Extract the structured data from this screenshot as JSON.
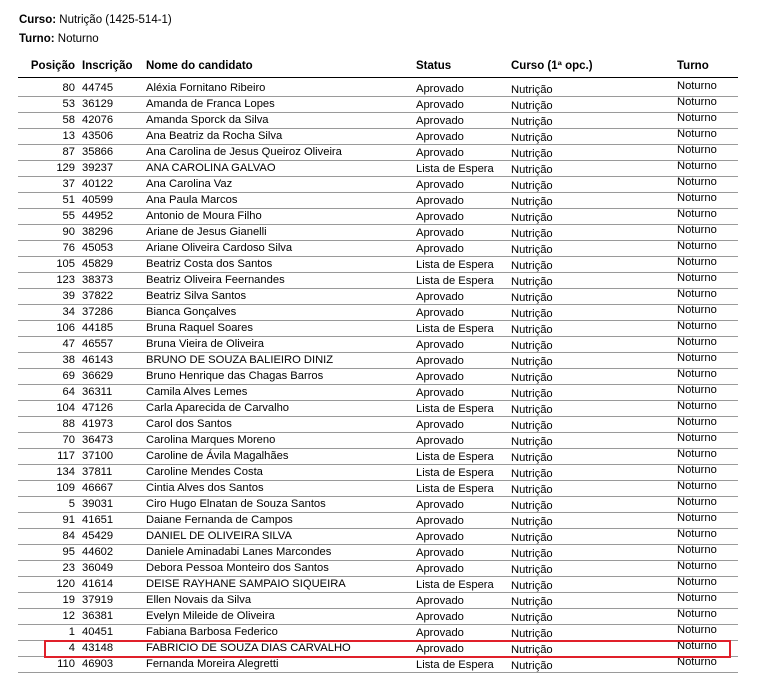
{
  "course": {
    "label": "Curso:",
    "value": "Nutrição (1425-514-1)"
  },
  "shift": {
    "label": "Turno:",
    "value": "Noturno"
  },
  "table": {
    "headers": {
      "posicao": "Posição",
      "inscricao": "Inscrição",
      "nome": "Nome do candidato",
      "status": "Status",
      "curso": "Curso (1ª opc.)",
      "turno": "Turno"
    },
    "rows": [
      {
        "pos": "80",
        "ins": "44745",
        "nome": "Aléxia Fornitano Ribeiro",
        "status": "Aprovado",
        "curso": "Nutrição",
        "turno": "Noturno"
      },
      {
        "pos": "53",
        "ins": "36129",
        "nome": "Amanda de Franca Lopes",
        "status": "Aprovado",
        "curso": "Nutrição",
        "turno": "Noturno"
      },
      {
        "pos": "58",
        "ins": "42076",
        "nome": "Amanda Sporck da Silva",
        "status": "Aprovado",
        "curso": "Nutrição",
        "turno": "Noturno"
      },
      {
        "pos": "13",
        "ins": "43506",
        "nome": "Ana Beatriz da Rocha Silva",
        "status": "Aprovado",
        "curso": "Nutrição",
        "turno": "Noturno"
      },
      {
        "pos": "87",
        "ins": "35866",
        "nome": "Ana Carolina de Jesus Queiroz Oliveira",
        "status": "Aprovado",
        "curso": "Nutrição",
        "turno": "Noturno"
      },
      {
        "pos": "129",
        "ins": "39237",
        "nome": "ANA CAROLINA GALVAO",
        "status": "Lista de Espera",
        "curso": "Nutrição",
        "turno": "Noturno"
      },
      {
        "pos": "37",
        "ins": "40122",
        "nome": "Ana Carolina Vaz",
        "status": "Aprovado",
        "curso": "Nutrição",
        "turno": "Noturno"
      },
      {
        "pos": "51",
        "ins": "40599",
        "nome": "Ana Paula Marcos",
        "status": "Aprovado",
        "curso": "Nutrição",
        "turno": "Noturno"
      },
      {
        "pos": "55",
        "ins": "44952",
        "nome": "Antonio de Moura Filho",
        "status": "Aprovado",
        "curso": "Nutrição",
        "turno": "Noturno"
      },
      {
        "pos": "90",
        "ins": "38296",
        "nome": "Ariane de Jesus Gianelli",
        "status": "Aprovado",
        "curso": "Nutrição",
        "turno": "Noturno"
      },
      {
        "pos": "76",
        "ins": "45053",
        "nome": "Ariane Oliveira Cardoso Silva",
        "status": "Aprovado",
        "curso": "Nutrição",
        "turno": "Noturno"
      },
      {
        "pos": "105",
        "ins": "45829",
        "nome": "Beatriz Costa dos Santos",
        "status": "Lista de Espera",
        "curso": "Nutrição",
        "turno": "Noturno"
      },
      {
        "pos": "123",
        "ins": "38373",
        "nome": "Beatriz Oliveira Feernandes",
        "status": "Lista de Espera",
        "curso": "Nutrição",
        "turno": "Noturno"
      },
      {
        "pos": "39",
        "ins": "37822",
        "nome": "Beatriz Silva Santos",
        "status": "Aprovado",
        "curso": "Nutrição",
        "turno": "Noturno"
      },
      {
        "pos": "34",
        "ins": "37286",
        "nome": "Bianca Gonçalves",
        "status": "Aprovado",
        "curso": "Nutrição",
        "turno": "Noturno"
      },
      {
        "pos": "106",
        "ins": "44185",
        "nome": "Bruna Raquel Soares",
        "status": "Lista de Espera",
        "curso": "Nutrição",
        "turno": "Noturno"
      },
      {
        "pos": "47",
        "ins": "46557",
        "nome": "Bruna Vieira de Oliveira",
        "status": "Aprovado",
        "curso": "Nutrição",
        "turno": "Noturno"
      },
      {
        "pos": "38",
        "ins": "46143",
        "nome": "BRUNO DE SOUZA BALIEIRO DINIZ",
        "status": "Aprovado",
        "curso": "Nutrição",
        "turno": "Noturno"
      },
      {
        "pos": "69",
        "ins": "36629",
        "nome": "Bruno Henrique das Chagas Barros",
        "status": "Aprovado",
        "curso": "Nutrição",
        "turno": "Noturno"
      },
      {
        "pos": "64",
        "ins": "36311",
        "nome": "Camila Alves Lemes",
        "status": "Aprovado",
        "curso": "Nutrição",
        "turno": "Noturno"
      },
      {
        "pos": "104",
        "ins": "47126",
        "nome": "Carla Aparecida de Carvalho",
        "status": "Lista de Espera",
        "curso": "Nutrição",
        "turno": "Noturno"
      },
      {
        "pos": "88",
        "ins": "41973",
        "nome": "Carol dos Santos",
        "status": "Aprovado",
        "curso": "Nutrição",
        "turno": "Noturno"
      },
      {
        "pos": "70",
        "ins": "36473",
        "nome": "Carolina Marques Moreno",
        "status": "Aprovado",
        "curso": "Nutrição",
        "turno": "Noturno"
      },
      {
        "pos": "117",
        "ins": "37100",
        "nome": "Caroline de Ávila Magalhães",
        "status": "Lista de Espera",
        "curso": "Nutrição",
        "turno": "Noturno"
      },
      {
        "pos": "134",
        "ins": "37811",
        "nome": "Caroline Mendes Costa",
        "status": "Lista de Espera",
        "curso": "Nutrição",
        "turno": "Noturno"
      },
      {
        "pos": "109",
        "ins": "46667",
        "nome": "Cintia Alves dos Santos",
        "status": "Lista de Espera",
        "curso": "Nutrição",
        "turno": "Noturno"
      },
      {
        "pos": "5",
        "ins": "39031",
        "nome": "Ciro Hugo Elnatan de Souza Santos",
        "status": "Aprovado",
        "curso": "Nutrição",
        "turno": "Noturno"
      },
      {
        "pos": "91",
        "ins": "41651",
        "nome": "Daiane Fernanda de Campos",
        "status": "Aprovado",
        "curso": "Nutrição",
        "turno": "Noturno"
      },
      {
        "pos": "84",
        "ins": "45429",
        "nome": "DANIEL DE OLIVEIRA SILVA",
        "status": "Aprovado",
        "curso": "Nutrição",
        "turno": "Noturno"
      },
      {
        "pos": "95",
        "ins": "44602",
        "nome": "Daniele Aminadabi Lanes Marcondes",
        "status": "Aprovado",
        "curso": "Nutrição",
        "turno": "Noturno"
      },
      {
        "pos": "23",
        "ins": "36049",
        "nome": "Debora Pessoa Monteiro dos Santos",
        "status": "Aprovado",
        "curso": "Nutrição",
        "turno": "Noturno"
      },
      {
        "pos": "120",
        "ins": "41614",
        "nome": "DEISE RAYHANE SAMPAIO SIQUEIRA",
        "status": "Lista de Espera",
        "curso": "Nutrição",
        "turno": "Noturno"
      },
      {
        "pos": "19",
        "ins": "37919",
        "nome": "Ellen Novais da Silva",
        "status": "Aprovado",
        "curso": "Nutrição",
        "turno": "Noturno"
      },
      {
        "pos": "12",
        "ins": "36381",
        "nome": "Evelyn Mileide de Oliveira",
        "status": "Aprovado",
        "curso": "Nutrição",
        "turno": "Noturno"
      },
      {
        "pos": "1",
        "ins": "40451",
        "nome": "Fabiana Barbosa Federico",
        "status": "Aprovado",
        "curso": "Nutrição",
        "turno": "Noturno"
      },
      {
        "pos": "4",
        "ins": "43148",
        "nome": "FABRICIO DE SOUZA DIAS CARVALHO",
        "status": "Aprovado",
        "curso": "Nutrição",
        "turno": "Noturno"
      },
      {
        "pos": "110",
        "ins": "46903",
        "nome": "Fernanda Moreira Alegretti",
        "status": "Lista de Espera",
        "curso": "Nutrição",
        "turno": "Noturno"
      }
    ]
  },
  "colors": {
    "highlight_border": "#e0202a",
    "row_rule": "#9a9a9a"
  }
}
